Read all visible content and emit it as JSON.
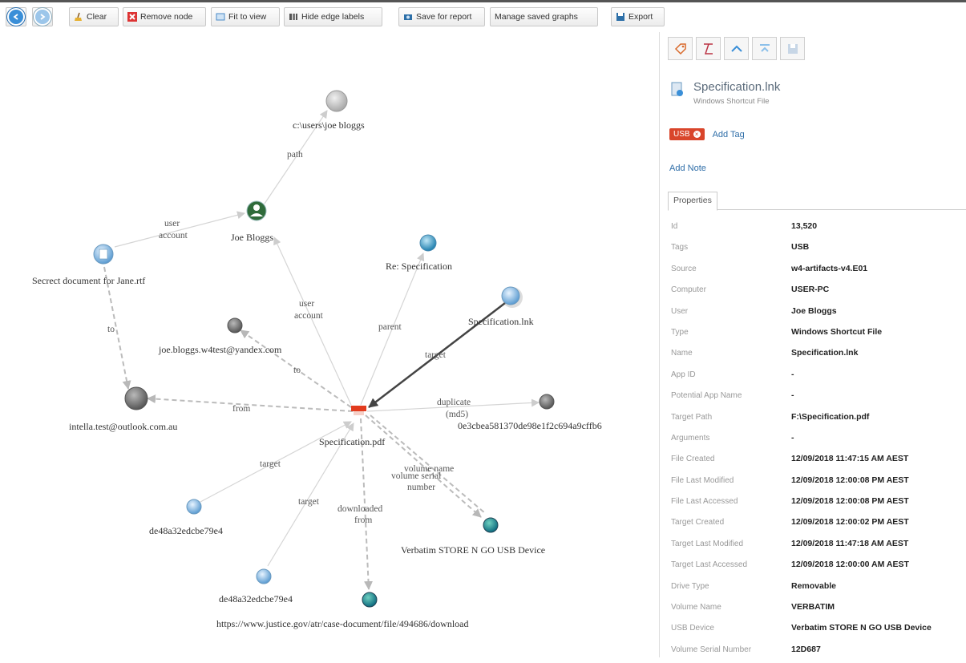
{
  "toolbar": {
    "clear": "Clear",
    "remove_node": "Remove node",
    "fit_to_view": "Fit to view",
    "hide_edge_labels": "Hide edge labels",
    "save_for_report": "Save for report",
    "manage_saved_graphs": "Manage saved graphs",
    "export": "Export"
  },
  "graph": {
    "nodes": {
      "users_path": "c:\\users\\joe bloggs",
      "joe_bloggs": "Joe Bloggs",
      "secret_doc": "Secrect document for Jane.rtf",
      "re_spec": "Re: Specification",
      "spec_lnk": "Specification.lnk",
      "yandex": "joe.bloggs.w4test@yandex.com",
      "outlook": "intella.test@outlook.com.au",
      "spec_pdf": "Specification.pdf",
      "hash": "0e3cbea581370de98e1f2c694a9cffb6",
      "usb": "Verbatim STORE N GO USB Device",
      "de48_1": "de48a32edcbe79e4",
      "de48_2": "de48a32edcbe79e4",
      "justice": "https://www.justice.gov/atr/case-document/file/494686/download"
    },
    "edges": {
      "path": "path",
      "user_account_1a": "user",
      "user_account_1b": "account",
      "user_account_2a": "user",
      "user_account_2b": "account",
      "to_1": "to",
      "to_2": "to",
      "parent": "parent",
      "target_1": "target",
      "from": "from",
      "duplicate_a": "duplicate",
      "duplicate_b": "(md5)",
      "volume_name": "volume name",
      "volume_serial_a": "volume serial",
      "volume_serial_b": "number",
      "target_2": "target",
      "target_3": "target",
      "downloaded_a": "downloaded",
      "downloaded_b": "from"
    }
  },
  "panel": {
    "title": "Specification.lnk",
    "subtitle": "Windows Shortcut File",
    "tag": "USB",
    "add_tag": "Add Tag",
    "add_note": "Add Note",
    "tab": "Properties",
    "properties": [
      {
        "key": "Id",
        "value": "13,520"
      },
      {
        "key": "Tags",
        "value": "USB"
      },
      {
        "key": "Source",
        "value": "w4-artifacts-v4.E01"
      },
      {
        "key": "Computer",
        "value": "USER-PC"
      },
      {
        "key": "User",
        "value": "Joe Bloggs"
      },
      {
        "key": "Type",
        "value": "Windows Shortcut File"
      },
      {
        "key": "Name",
        "value": "Specification.lnk"
      },
      {
        "key": "App ID",
        "value": "-"
      },
      {
        "key": "Potential App Name",
        "value": "-"
      },
      {
        "key": "Target Path",
        "value": "F:\\Specification.pdf"
      },
      {
        "key": "Arguments",
        "value": "-"
      },
      {
        "key": "File Created",
        "value": "12/09/2018 11:47:15 AM AEST"
      },
      {
        "key": "File Last Modified",
        "value": "12/09/2018 12:00:08 PM AEST"
      },
      {
        "key": "File Last Accessed",
        "value": "12/09/2018 12:00:08 PM AEST"
      },
      {
        "key": "Target Created",
        "value": "12/09/2018 12:00:02 PM AEST"
      },
      {
        "key": "Target Last Modified",
        "value": "12/09/2018 11:47:18 AM AEST"
      },
      {
        "key": "Target Last Accessed",
        "value": "12/09/2018 12:00:00 AM AEST"
      },
      {
        "key": "Drive Type",
        "value": "Removable"
      },
      {
        "key": "Volume Name",
        "value": "VERBATIM"
      },
      {
        "key": "USB Device",
        "value": "Verbatim STORE N GO USB Device"
      },
      {
        "key": "Volume Serial Number",
        "value": "12D687"
      }
    ]
  }
}
